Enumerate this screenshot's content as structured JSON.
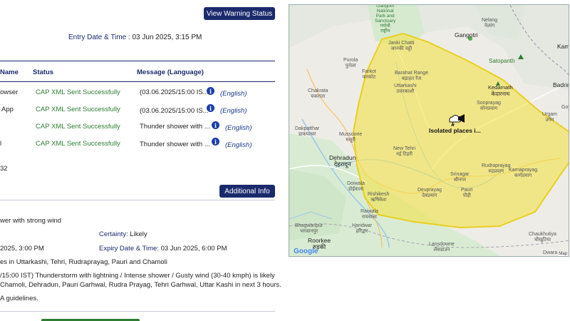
{
  "buttons": {
    "view_warning_status": "View Warning Status",
    "additional_info": "Additional Info"
  },
  "entry": {
    "label": "Entry Date & Time :",
    "value": "03 Jun 2025, 3:15 PM"
  },
  "table": {
    "headers": [
      "Name",
      "Status",
      "Message (Language)"
    ],
    "rows": [
      {
        "name": "owser",
        "status": "CAP XML Sent Successfully",
        "message": "(03.06.2025/15:00 IS...",
        "language": "(English)"
      },
      {
        "name": "App",
        "status": "CAP XML Sent Successfully",
        "message": "(03.06.2025/15:00 IS...",
        "language": "(English)"
      },
      {
        "name": "",
        "status": "CAP XML Sent Successfully",
        "message": "Thunder shower with ...",
        "language": "(English)"
      },
      {
        "name": "l",
        "status": "CAP XML Sent Successfully",
        "message": "Thunder shower with ...",
        "language": "(English)"
      }
    ],
    "footer_count": "32"
  },
  "details": {
    "event": "wer with strong wind",
    "certainty_label": "Certainty:",
    "certainty_value": "Likely",
    "onset": "2025, 3:00 PM",
    "expiry_label": "Expiry Date & Time:",
    "expiry_value": "03 Jun 2025, 6:00 PM",
    "area": "es in Uttarkashi, Tehri, Rudraprayag, Pauri and Chamoli",
    "desc_line1": "/15:00 IST) Thunderstorm with lightning / Intense shower / Gusty wind (30-40 kmph) is likely",
    "desc_line2": "Chamoli, Dehradun, Pauri Garhwal, Rudra Prayag, Tehri Garhwal, Uttar Kashi in next 3 hours.",
    "guidelines": "A guidelines."
  },
  "map": {
    "polygon_label": "Isolated places i...",
    "attribution": "Map",
    "google": "Google",
    "places": {
      "gangotri": "Gangotri",
      "nelang": "Nelang\nनेलांग",
      "gangotri_np": "Gangotri\nNational\nPark and\nSanctuary\nगंगोत्री\nराष्ट्रीय",
      "kame": "Kame",
      "janki_chatti": "Janki Chatti\nजानकी चट्टी",
      "satopanth": "Satopanth",
      "purola": "Purola\nपुरोला",
      "barahat": "Barahat Range\nबड़ाहत रेंज",
      "farkot": "Farkot\nफरकोट",
      "uttarkashi": "Uttarkashi\nउत्तरकाशी",
      "kedarnath": "Kedarnath\nकेदारनाथ",
      "badri": "Badrin",
      "chakrata": "Chakrata\nचकराता",
      "sonprayag": "Sonprayag\nसोनप्रयाग",
      "urgam": "Urgam\nउर्गम",
      "goy": "Goy",
      "dakpatthar": "Dakpatthar\nडाकपत्थर",
      "mussoorie": "Mussoorie\nमसूरी",
      "dehradun": "Dehradun\nदेहरादून",
      "new_tehri": "New Tehri\nनई टिहरी",
      "rudraprayag": "Rudraprayag\nरुद्रप्रयाग",
      "karnaprayag": "Karnaprayag\nकर्णप्रयाग",
      "srinagar": "Srinagar\nश्रीनगर",
      "doiwala": "Doiwala\nडोईवाला",
      "rishikesh": "Rishikesh\nऋषिकेश",
      "devprayag": "Devprayag\nदेवप्रयाग",
      "pauri": "Pauri\nपौड़ी",
      "raiwala": "Raiwala\nरायवाला",
      "bhagwanpur": "Bhagwanpur\nभगवानपुर",
      "haridwar": "Haridwar\nहरिद्वार",
      "roorkee": "Roorkee\nरुड़की",
      "lansdowne": "Lansdowne\nलैंसडाउन",
      "chaukhutiya": "Chaukhutiya\nचौखुटिया",
      "dwara": "Dwara"
    }
  },
  "colors": {
    "navy": "#1a2a6c",
    "status_green": "#2e7d32",
    "info_blue": "#1c3ea8",
    "warning_fill": "#f2e34a",
    "warning_stroke": "#e9cf20"
  }
}
